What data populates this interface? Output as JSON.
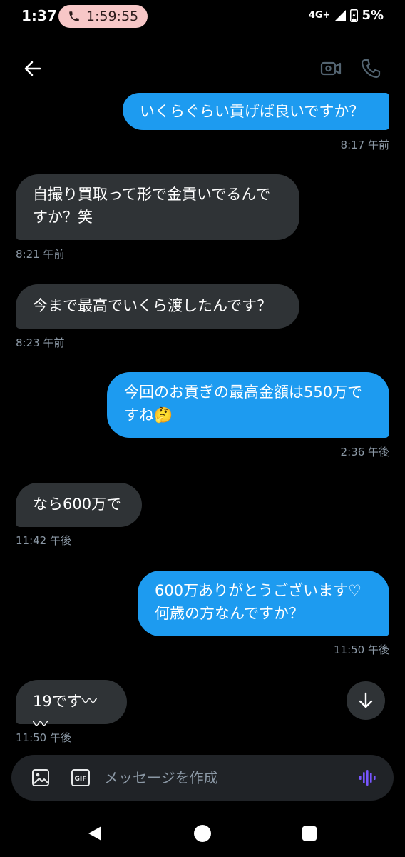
{
  "status_bar": {
    "time": "1:37",
    "call_timer": "1:59:55",
    "network": "4G+",
    "battery": "5%"
  },
  "header": {
    "back_icon": "arrow-left-icon",
    "video_icon": "video-camera-icon",
    "phone_icon": "phone-icon"
  },
  "messages": [
    {
      "direction": "out",
      "text": "いくらぐらい貢げば良いですか？",
      "time": "8:17 午前"
    },
    {
      "direction": "in",
      "text": "自撮り買取って形で金貢いでるんで\nすか？笑",
      "time": "8:21 午前"
    },
    {
      "direction": "in",
      "text": "今まで最高でいくら渡したんです？",
      "time": "8:23 午前"
    },
    {
      "direction": "out",
      "text": "今回のお貢ぎの最高金額は550万で\nすね🤔",
      "time": "2:36 午後"
    },
    {
      "direction": "in",
      "text": "なら600万で",
      "time": "11:42 午後"
    },
    {
      "direction": "out",
      "text": "600万ありがとうございます♡\n何歳の方なんですか？",
      "time": "11:50 午後"
    },
    {
      "direction": "in",
      "text": "19です〰〰",
      "time": "11:50 午後"
    }
  ],
  "composer": {
    "placeholder": "メッセージを作成",
    "gif_label": "GIF"
  },
  "colors": {
    "outgoing_bubble": "#1d9bf0",
    "incoming_bubble": "#2f3336",
    "timestamp": "#8b98a5",
    "voice_accent": "#7856ff",
    "call_pill": "#f7c7c7"
  }
}
